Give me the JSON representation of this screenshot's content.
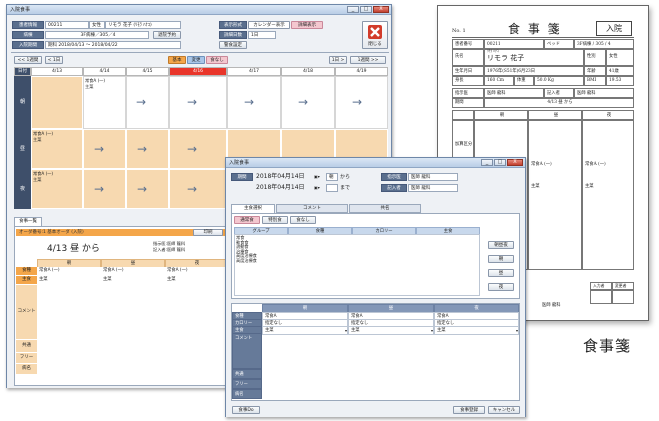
{
  "w1": {
    "title": "入院食事",
    "controls": [
      "_",
      "□",
      "X"
    ],
    "patient": {
      "id_label": "患者情報",
      "id": "00211",
      "sex": "女性",
      "name": "リモラ 花子 (ﾘﾓﾗ ﾊﾅｺ)",
      "ward_label": "病棟",
      "ward": "3F病棟／305／4",
      "discharge_btn": "退院予約",
      "admit_label": "入院期間",
      "admit": "期科 2018/04/13 ～ 2018/04/22"
    },
    "display": {
      "label": "表示形式",
      "opt1": "カレンダー表示",
      "opt2": "詳細表示",
      "days_label": "詳細日数",
      "days": "1日",
      "settings_btn": "警食設定"
    },
    "close_btn": "閉じる",
    "nav": {
      "prev_week": "<< 1週間",
      "prev_day": "< 1日",
      "next_day": "1日 >",
      "next_week": "1週間 >>",
      "filter1": "基本",
      "filter2": "変更",
      "filter3": "食なし"
    },
    "days_header": "日付",
    "days": [
      "4/13",
      "4/14",
      "4/15",
      "4/16",
      "4/17",
      "4/18",
      "4/19"
    ],
    "meals": [
      "朝",
      "昼",
      "夜"
    ],
    "entry_breakfast": "常食A (一)\n主菜",
    "entry_lunch": "常食A (一)\n主菜",
    "entry_dinner": "常食A (一)\n主菜",
    "arrow": "→",
    "list_tab": "食事一覧",
    "order_title": "オーダ番号:1 基本オーダ (入院)",
    "print_btn": "印刷",
    "order_date": "4/13 昼 から",
    "order_doc": "指示医:医師 龍科\n記入者:医師 龍科",
    "cols": [
      "朝",
      "昼",
      "夜"
    ],
    "rows": [
      {
        "label": "食種",
        "v": [
          "常食A (一)",
          "常食A (一)",
          "常食A (一)"
        ]
      },
      {
        "label": "主食",
        "v": [
          "主菜",
          "主菜",
          "主菜"
        ]
      },
      {
        "label": "コメント",
        "v": [
          "",
          "",
          ""
        ]
      },
      {
        "label": "共通",
        "v": [
          "",
          "",
          ""
        ]
      },
      {
        "label": "フリー",
        "v": [
          "",
          "",
          ""
        ]
      },
      {
        "label": "病名",
        "v": [
          "",
          "",
          ""
        ]
      }
    ]
  },
  "w2": {
    "title": "入院食事",
    "period_label": "期間",
    "from_date": "2018年04月14日",
    "from_meal": "朝",
    "from_suffix": "から",
    "to_date": "2018年04月14日",
    "to_suffix": "まで",
    "doctor_label": "指示医",
    "doctor": "医師 龍科",
    "writer_label": "記入者",
    "writer": "医師 龍科",
    "tabs": [
      "主食選択",
      "コメント",
      "共名"
    ],
    "subtabs": [
      "通常食",
      "特別食",
      "食なし"
    ],
    "grid_cols": [
      "グループ",
      "食種",
      "カロリー",
      "主食"
    ],
    "groups": [
      "常食",
      "軟食食",
      "流動食",
      "治療食",
      "高度治療食",
      "高度治療食"
    ],
    "side_btns": [
      "朝昼夜",
      "朝",
      "昼",
      "夜"
    ],
    "meal_cols": [
      "朝",
      "昼",
      "夜"
    ],
    "meal_rows": [
      {
        "label": "食種",
        "v": [
          "常食A",
          "常食A",
          "常食A"
        ]
      },
      {
        "label": "カロリー",
        "v": [
          "指定なし",
          "指定なし",
          "指定なし"
        ]
      },
      {
        "label": "主食",
        "v": [
          "主菜",
          "主菜",
          "主菜"
        ]
      },
      {
        "label": "コメント",
        "v": [
          "",
          "",
          ""
        ]
      },
      {
        "label": "共通",
        "v": [
          "",
          "",
          ""
        ]
      },
      {
        "label": "フリー",
        "v": [
          "",
          "",
          ""
        ]
      },
      {
        "label": "病名",
        "v": [
          "",
          "",
          ""
        ]
      }
    ],
    "btn_left": "食事Do",
    "btn_ok": "食事登録",
    "btn_cancel": "キャンセル"
  },
  "doc": {
    "no": "No. 1",
    "title": "食 事 箋",
    "stamp": "入院",
    "id_label": "患者番号",
    "id": "00211",
    "bed_label": "ベッド",
    "bed": "3F病棟 / 305 / 4",
    "name_label": "氏名",
    "kana": "ﾘﾓﾗ ﾊﾅｺ",
    "name": "リモラ 花子",
    "sex_label": "性別",
    "sex": "女性",
    "dob_label": "生年月日",
    "dob": "1976年(S51年)6月23日",
    "age_label": "年齢",
    "age": "41歳",
    "height_label": "身長",
    "height": "160 Cm",
    "weight_label": "体重",
    "weight": "50.0 Kg",
    "bmi_label": "BMI",
    "bmi": "19.53",
    "doctor_label": "指示医",
    "doctor": "医師 龍科",
    "writer_label": "記入者",
    "writer": "医師 龍科",
    "period_label": "期間",
    "period": "4/13 昼 から",
    "cols": [
      "朝",
      "昼",
      "夜"
    ],
    "row_label": "加算区分",
    "vals": [
      "",
      "常食A (一)",
      "常食A (一)"
    ],
    "vals2": [
      "",
      "主菜",
      "主菜"
    ],
    "sign1": "入力者",
    "sign2": "変更者",
    "footer": "医師 龍科"
  },
  "caption": "食事箋"
}
